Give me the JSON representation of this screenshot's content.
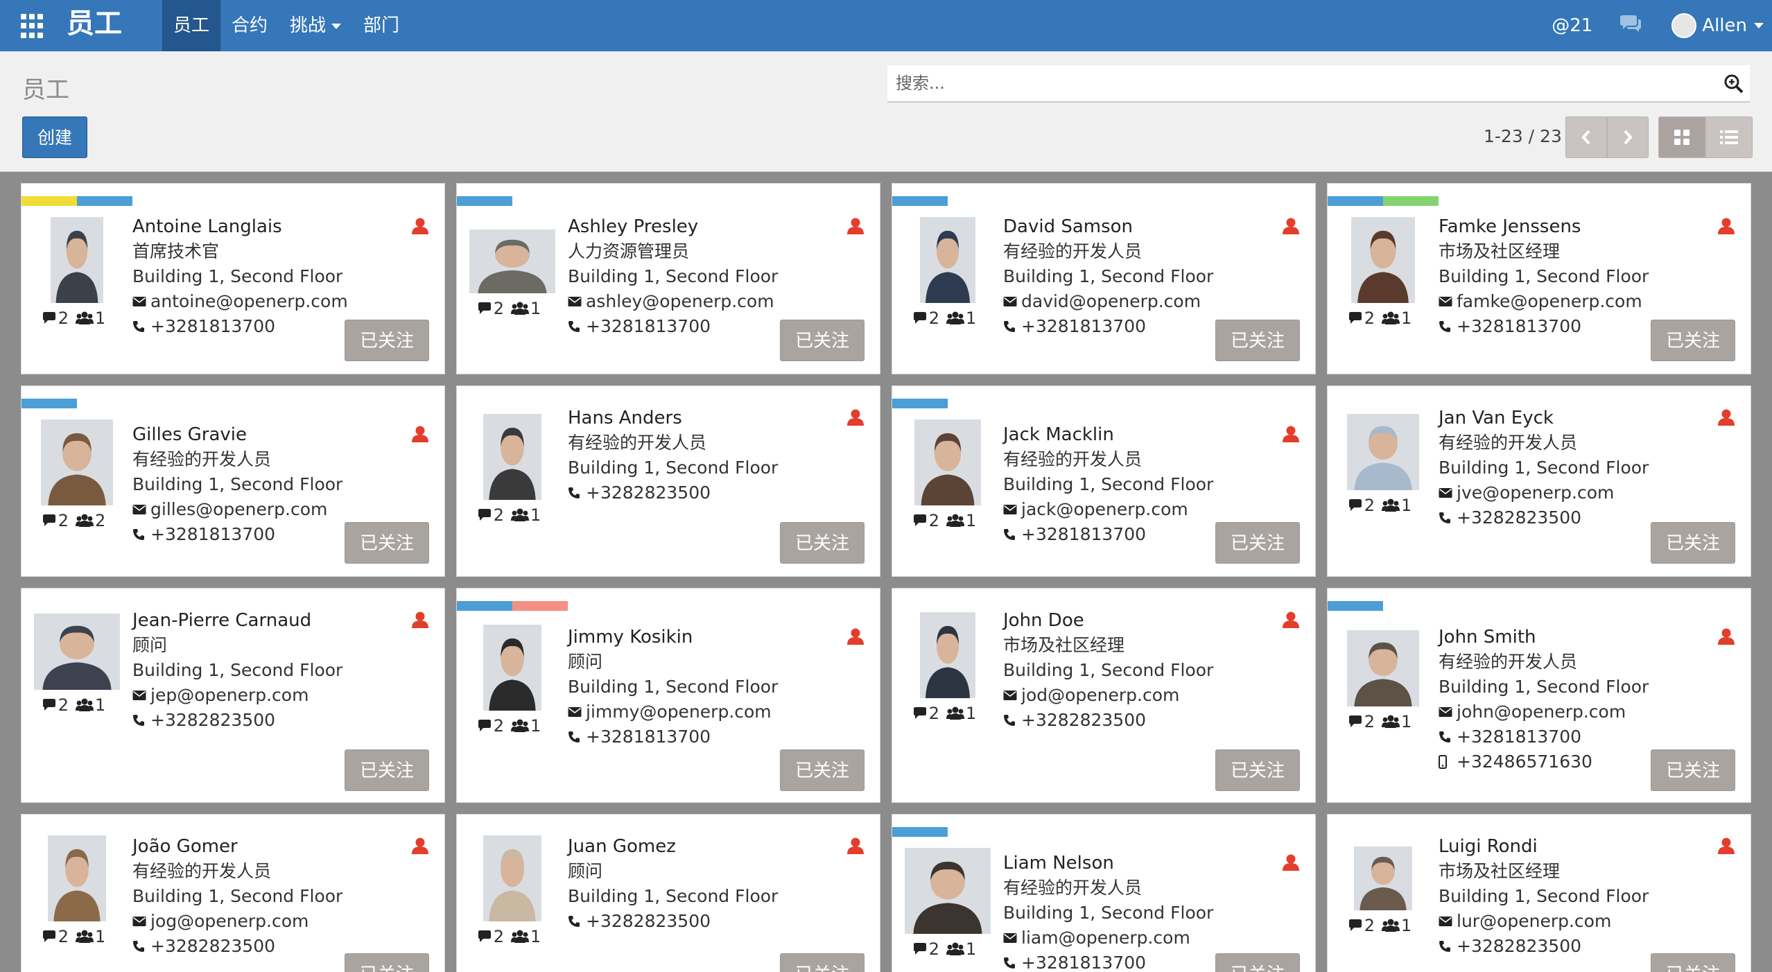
{
  "navbar": {
    "brand": "员工",
    "menu": [
      {
        "label": "员工",
        "active": true
      },
      {
        "label": "合约"
      },
      {
        "label": "挑战"
      },
      {
        "label": "部门"
      }
    ],
    "mentions": "@21",
    "user": "Allen",
    "color": "#3577b8"
  },
  "control": {
    "breadcrumb": "员工",
    "search_placeholder": "搜索...",
    "create_label": "创建",
    "pager": "1-23 / 23"
  },
  "follow_label": "已关注",
  "tag_colors": {
    "yellow": "#f2dc36",
    "blue": "#4b9ed6",
    "green": "#85d370",
    "salmon": "#f39083"
  },
  "employees": [
    {
      "name": "Antoine Langlais",
      "job": "首席技术官",
      "location": "Building 1, Second Floor",
      "email": "antoine@openerp.com",
      "phone": "+3281813700",
      "messages": "2",
      "followers": "1",
      "tags": [
        "yellow",
        "blue"
      ]
    },
    {
      "name": "Ashley Presley",
      "job": "人力资源管理员",
      "location": "Building 1, Second Floor",
      "email": "ashley@openerp.com",
      "phone": "+3281813700",
      "messages": "2",
      "followers": "1",
      "tags": [
        "blue"
      ]
    },
    {
      "name": "David Samson",
      "job": "有经验的开发人员",
      "location": "Building 1, Second Floor",
      "email": "david@openerp.com",
      "phone": "+3281813700",
      "messages": "2",
      "followers": "1",
      "tags": [
        "blue"
      ]
    },
    {
      "name": "Famke Jenssens",
      "job": "市场及社区经理",
      "location": "Building 1, Second Floor",
      "email": "famke@openerp.com",
      "phone": "+3281813700",
      "messages": "2",
      "followers": "1",
      "tags": [
        "blue",
        "green"
      ]
    },
    {
      "name": "Gilles Gravie",
      "job": "有经验的开发人员",
      "location": "Building 1, Second Floor",
      "email": "gilles@openerp.com",
      "phone": "+3281813700",
      "messages": "2",
      "followers": "2",
      "tags": [
        "blue"
      ]
    },
    {
      "name": "Hans Anders",
      "job": "有经验的开发人员",
      "location": "Building 1, Second Floor",
      "phone": "+3282823500",
      "messages": "2",
      "followers": "1",
      "tags": []
    },
    {
      "name": "Jack Macklin",
      "job": "有经验的开发人员",
      "location": "Building 1, Second Floor",
      "email": "jack@openerp.com",
      "phone": "+3281813700",
      "messages": "2",
      "followers": "1",
      "tags": [
        "blue"
      ]
    },
    {
      "name": "Jan Van Eyck",
      "job": "有经验的开发人员",
      "location": "Building 1, Second Floor",
      "email": "jve@openerp.com",
      "phone": "+3282823500",
      "messages": "2",
      "followers": "1",
      "tags": []
    },
    {
      "name": "Jean-Pierre Carnaud",
      "job": "顾问",
      "location": "Building 1, Second Floor",
      "email": "jep@openerp.com",
      "phone": "+3282823500",
      "messages": "2",
      "followers": "1",
      "tags": []
    },
    {
      "name": "Jimmy Kosikin",
      "job": "顾问",
      "location": "Building 1, Second Floor",
      "email": "jimmy@openerp.com",
      "phone": "+3281813700",
      "messages": "2",
      "followers": "1",
      "tags": [
        "blue",
        "salmon"
      ]
    },
    {
      "name": "John Doe",
      "job": "市场及社区经理",
      "location": "Building 1, Second Floor",
      "email": "jod@openerp.com",
      "phone": "+3282823500",
      "messages": "2",
      "followers": "1",
      "tags": []
    },
    {
      "name": "John Smith",
      "job": "有经验的开发人员",
      "location": "Building 1, Second Floor",
      "email": "john@openerp.com",
      "phone": "+3281813700",
      "mobile": "+32486571630",
      "messages": "2",
      "followers": "1",
      "tags": [
        "blue"
      ]
    },
    {
      "name": "João Gomer",
      "job": "有经验的开发人员",
      "location": "Building 1, Second Floor",
      "email": "jog@openerp.com",
      "phone": "+3282823500",
      "messages": "2",
      "followers": "1",
      "tags": []
    },
    {
      "name": "Juan Gomez",
      "job": "顾问",
      "location": "Building 1, Second Floor",
      "phone": "+3282823500",
      "messages": "2",
      "followers": "1",
      "tags": []
    },
    {
      "name": "Liam Nelson",
      "job": "有经验的开发人员",
      "location": "Building 1, Second Floor",
      "email": "liam@openerp.com",
      "phone": "+3281813700",
      "messages": "2",
      "followers": "1",
      "tags": [
        "blue"
      ]
    },
    {
      "name": "Luigi Rondi",
      "job": "市场及社区经理",
      "location": "Building 1, Second Floor",
      "email": "lur@openerp.com",
      "phone": "+3282823500",
      "messages": "2",
      "followers": "1",
      "tags": []
    }
  ]
}
